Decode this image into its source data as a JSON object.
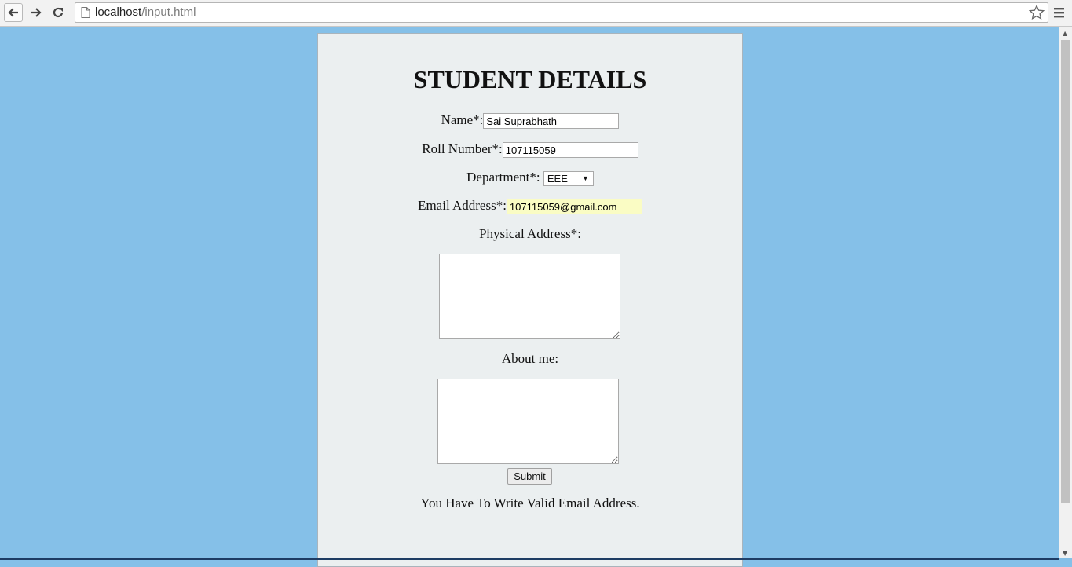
{
  "browser": {
    "url_host": "localhost",
    "url_path": "/input.html",
    "icons": [
      "back-arrow-icon",
      "forward-arrow-icon",
      "reload-icon",
      "page-icon",
      "bookmark-star-icon",
      "menu-icon"
    ]
  },
  "form": {
    "title": "STUDENT DETAILS",
    "name_label": "Name*:",
    "name_value": "Sai Suprabhath",
    "roll_label": "Roll Number*:",
    "roll_value": "107115059",
    "dept_label": "Department*:",
    "dept_selected": "EEE",
    "email_label": "Email Address*:",
    "email_value": "107115059@gmail.com",
    "address_label": "Physical Address*:",
    "address_value": "",
    "about_label": "About me:",
    "about_value": "",
    "submit_label": "Submit",
    "message": "You Have To Write Valid Email Address."
  },
  "colors": {
    "page_background": "#85c0e8",
    "panel_background": "#ebeff0",
    "autofill_background": "#fafcc4"
  }
}
